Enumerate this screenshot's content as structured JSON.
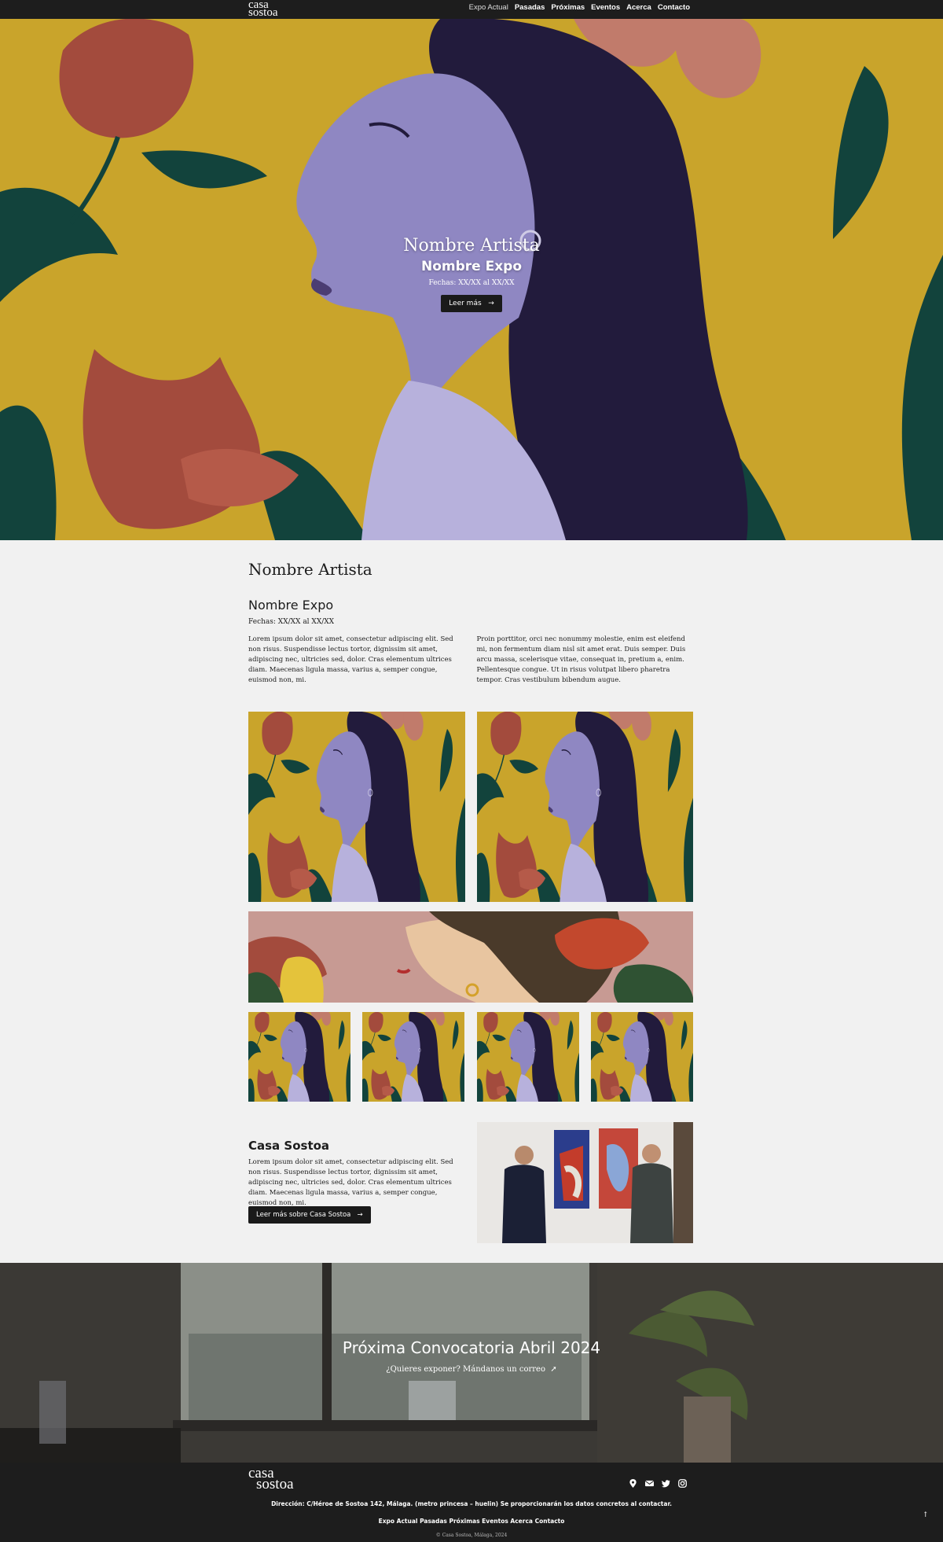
{
  "nav": {
    "logo_line1": "casa",
    "logo_line2": "sostoa",
    "links": [
      "Expo Actual",
      "Pasadas",
      "Próximas",
      "Eventos",
      "Acerca",
      "Contacto"
    ]
  },
  "hero": {
    "artist": "Nombre Artista",
    "expo": "Nombre Expo",
    "dates": "Fechas: XX/XX al XX/XX",
    "button": "Leer más",
    "button_icon": "arrow-right-icon"
  },
  "exhibition": {
    "artist": "Nombre Artista",
    "expo": "Nombre Expo",
    "dates": "Fechas: XX/XX al XX/XX",
    "col1": "Lorem ipsum dolor sit amet, consectetur adipiscing elit. Sed non risus. Suspendisse lectus tortor, dignissim sit amet, adipiscing nec, ultricies sed, dolor. Cras elementum ultrices diam. Maecenas ligula massa, varius a, semper congue, euismod non, mi.",
    "col2": "Proin porttitor, orci nec nonummy molestie, enim est eleifend mi, non fermentum diam nisl sit amet erat. Duis semper. Duis arcu massa, scelerisque vitae, consequat in, pretium a, enim. Pellentesque congue. Ut in risus volutpat libero pharetra tempor. Cras vestibulum bibendum augue."
  },
  "about": {
    "title": "Casa Sostoa",
    "text": "Lorem ipsum dolor sit amet, consectetur adipiscing elit. Sed non risus. Suspendisse lectus tortor, dignissim sit amet, adipiscing nec, ultricies sed, dolor. Cras elementum ultrices diam. Maecenas ligula massa, varius a, semper congue, euismod non, mi.",
    "button": "Leer más sobre Casa Sostoa"
  },
  "call": {
    "title": "Próxima Convocatoria Abril 2024",
    "subtitle": "¿Quieres exponer? Mándanos un correo",
    "subtitle_icon": "paper-plane-icon"
  },
  "footer": {
    "logo_line1": "casa",
    "logo_line2": "sostoa",
    "icons": [
      "map-pin-icon",
      "envelope-icon",
      "twitter-icon",
      "instagram-icon"
    ],
    "address": "Dirección: C/Héroe de Sostoa 142, Málaga. (metro princesa – huelin) Se proporcionarán los datos concretos al contactar.",
    "links": "Expo Actual Pasadas Próximas Eventos Acerca Contacto",
    "copyright": "© Casa Sostoa, Málaga, 2024",
    "back_to_top": "↑"
  },
  "colors": {
    "nav_bg": "#1d1d1d",
    "page_bg": "#f1f1f1",
    "mustard": "#c9a42b",
    "lavender": "#8f87c2",
    "hair": "#221b3c",
    "terracotta": "#a34b3d",
    "leaf": "#12433c"
  }
}
